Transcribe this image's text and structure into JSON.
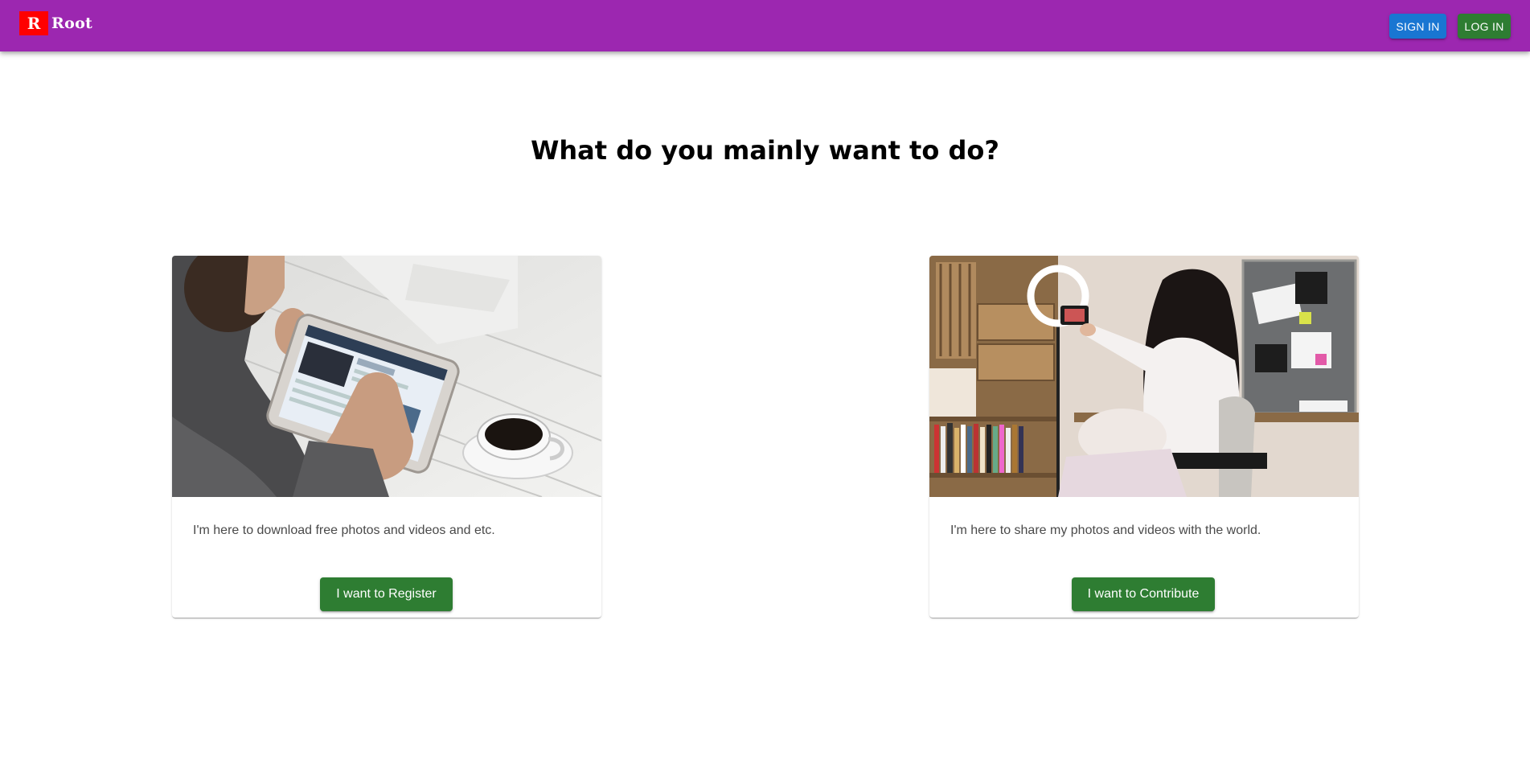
{
  "header": {
    "logo_letter": "R",
    "logo_text": "Root",
    "signin_label": "SIGN IN",
    "login_label": "LOG IN",
    "colors": {
      "appbar": "#9c27b0",
      "logo_mark": "#ff0000",
      "signin": "#1976d2",
      "login": "#2e7d32"
    }
  },
  "main": {
    "heading": "What do you mainly want to do?",
    "cards": [
      {
        "image_icon": "man-with-tablet-and-coffee-photo",
        "description": "I'm here to download free photos and videos and etc.",
        "button_label": "I want to Register"
      },
      {
        "image_icon": "woman-recording-with-ring-light-photo",
        "description": "I'm here to share my photos and videos with the world.",
        "button_label": "I want to Contribute"
      }
    ],
    "button_color": "#2e7d32"
  }
}
